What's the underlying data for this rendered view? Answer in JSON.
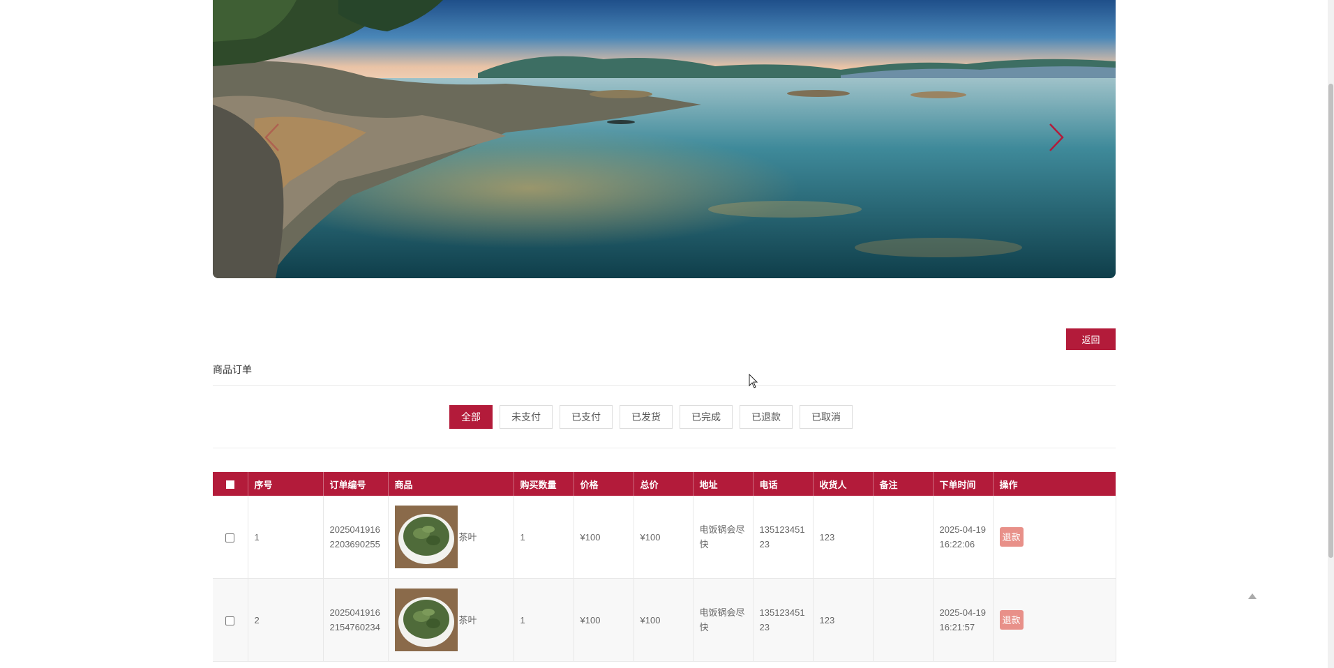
{
  "page": {
    "back_label": "返回",
    "section_title": "商品订单"
  },
  "theme": {
    "accent": "#b31b3a",
    "refund_bg": "#e89089"
  },
  "carousel": {
    "prev_icon": "chevron-left-icon",
    "next_icon": "chevron-right-icon"
  },
  "tabs": [
    {
      "label": "全部",
      "active": true
    },
    {
      "label": "未支付",
      "active": false
    },
    {
      "label": "已支付",
      "active": false
    },
    {
      "label": "已发货",
      "active": false
    },
    {
      "label": "已完成",
      "active": false
    },
    {
      "label": "已退款",
      "active": false
    },
    {
      "label": "已取消",
      "active": false
    }
  ],
  "table": {
    "headers": [
      "序号",
      "订单编号",
      "商品",
      "购买数量",
      "价格",
      "总价",
      "地址",
      "电话",
      "收货人",
      "备注",
      "下单时间",
      "操作"
    ],
    "rows": [
      {
        "index": "1",
        "order_no": "20250419162203690255",
        "product": "茶叶",
        "qty": "1",
        "price": "¥100",
        "total": "¥100",
        "address": "电饭锅会尽快",
        "phone": "13512345123",
        "receiver": "123",
        "note": "",
        "time": "2025-04-19 16:22:06",
        "action": "退款"
      },
      {
        "index": "2",
        "order_no": "20250419162154760234",
        "product": "茶叶",
        "qty": "1",
        "price": "¥100",
        "total": "¥100",
        "address": "电饭锅会尽快",
        "phone": "13512345123",
        "receiver": "123",
        "note": "",
        "time": "2025-04-19 16:21:57",
        "action": "退款"
      }
    ]
  }
}
